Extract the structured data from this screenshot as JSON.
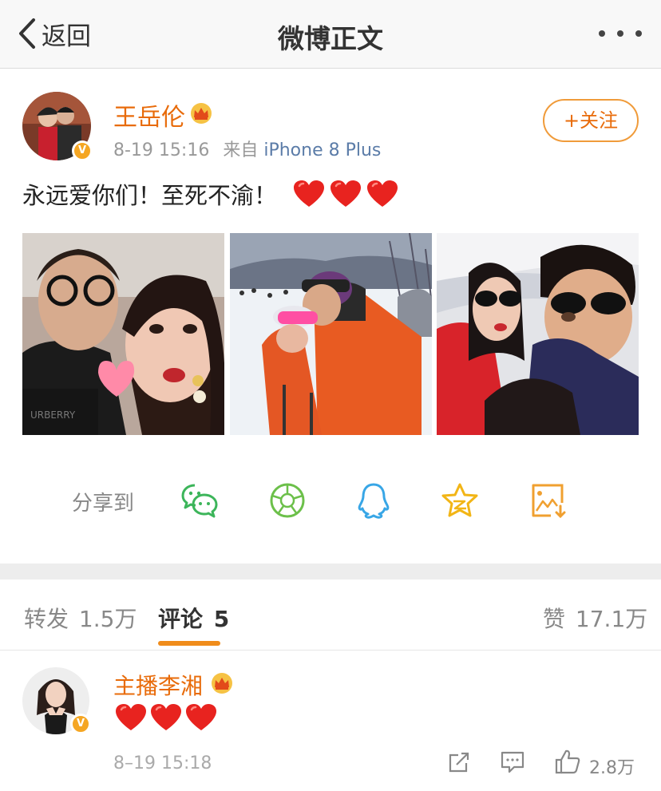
{
  "nav": {
    "back_label": "返回",
    "title": "微博正文"
  },
  "post": {
    "author": "王岳伦",
    "verified_badge": "V",
    "time": "8-19 15:16",
    "source_prefix": "来自",
    "device": "iPhone 8 Plus",
    "follow_label": "+关注",
    "text": "永远爱你们！至死不渝！",
    "hearts": 3
  },
  "share": {
    "label": "分享到",
    "targets": [
      "wechat-icon",
      "moments-icon",
      "qq-icon",
      "qzone-icon",
      "save-image-icon"
    ]
  },
  "tabs": {
    "repost_label": "转发",
    "repost_count": "1.5万",
    "comment_label": "评论",
    "comment_count": "5",
    "like_label": "赞",
    "like_count": "17.1万"
  },
  "comment": {
    "author": "主播李湘",
    "verified_badge": "V",
    "hearts": 3,
    "time": "8–19 15:18",
    "like_count": "2.8万"
  },
  "colors": {
    "accent": "#e86b0a",
    "link": "#5b7ca8",
    "heart": "#e8231f"
  }
}
